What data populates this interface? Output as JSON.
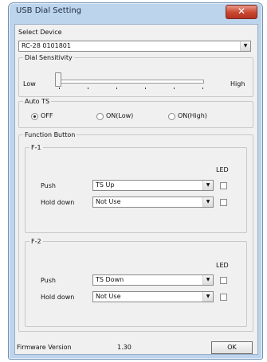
{
  "window": {
    "title": "USB Dial Setting",
    "close_glyph": "✕"
  },
  "select_device": {
    "label": "Select Device",
    "value": "RC-28 0101801"
  },
  "dial_sensitivity": {
    "label": "Dial Sensitivity",
    "low": "Low",
    "high": "High",
    "level": 0
  },
  "auto_ts": {
    "label": "Auto TS",
    "options": [
      {
        "label": "OFF",
        "selected": true
      },
      {
        "label": "ON(Low)",
        "selected": false
      },
      {
        "label": "ON(High)",
        "selected": false
      }
    ]
  },
  "function_button": {
    "label": "Function Button",
    "led_label": "LED",
    "f1": {
      "label": "F-1",
      "push_label": "Push",
      "push_value": "TS Up",
      "hold_label": "Hold down",
      "hold_value": "Not Use"
    },
    "f2": {
      "label": "F-2",
      "push_label": "Push",
      "push_value": "TS Down",
      "hold_label": "Hold down",
      "hold_value": "Not Use"
    }
  },
  "footer": {
    "firmware_label": "Firmware Version",
    "firmware_value": "1.30",
    "ok_label": "OK"
  },
  "icons": {
    "dropdown": "chevron-down-icon",
    "close": "close-icon"
  },
  "colors": {
    "titlebar": "#bcd4ec",
    "close_button": "#c9472f",
    "client": "#f0f0f0"
  }
}
